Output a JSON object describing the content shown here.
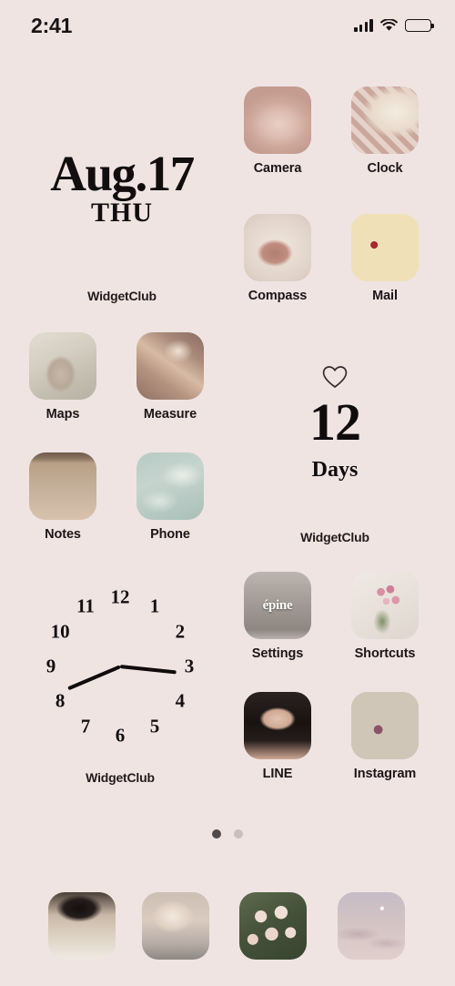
{
  "status_bar": {
    "time": "2:41",
    "signal_icon": "cellular-bars-icon",
    "wifi_icon": "wifi-icon",
    "battery_icon": "battery-full-icon"
  },
  "wallpaper_color": "#efe4e2",
  "widgets": {
    "date": {
      "date_text": "Aug.17",
      "day_of_week": "THU",
      "attribution": "WidgetClub"
    },
    "countdown": {
      "heart_icon": "heart-outline-icon",
      "number": "12",
      "unit": "Days",
      "attribution": "WidgetClub"
    },
    "clock": {
      "numerals": [
        "12",
        "1",
        "2",
        "3",
        "4",
        "5",
        "6",
        "7",
        "8",
        "9",
        "10",
        "11"
      ],
      "hour_hand_angle": 247,
      "minute_hand_angle": 96,
      "attribution": "WidgetClub"
    }
  },
  "apps": [
    {
      "label": "Camera",
      "icon_name": "camera-app-icon",
      "art": "glass-heart-perfume-bottle",
      "col": 0,
      "row": 0
    },
    {
      "label": "Clock",
      "icon_name": "clock-app-icon",
      "art": "white-cat-on-checkered-blanket",
      "col": 1,
      "row": 0
    },
    {
      "label": "Compass",
      "icon_name": "compass-app-icon",
      "art": "hand-in-bath-foam",
      "col": 0,
      "row": 1
    },
    {
      "label": "Mail",
      "icon_name": "mail-app-icon",
      "art": "cupcakes-on-tray",
      "col": 1,
      "row": 1
    },
    {
      "label": "Maps",
      "icon_name": "maps-app-icon",
      "art": "bunny-plush-on-bed",
      "col": 0,
      "row": 2
    },
    {
      "label": "Measure",
      "icon_name": "measure-app-icon",
      "art": "ornate-crystal-jewelry",
      "col": 1,
      "row": 2
    },
    {
      "label": "Notes",
      "icon_name": "notes-app-icon",
      "art": "clothes-on-hangers",
      "col": 0,
      "row": 3
    },
    {
      "label": "Phone",
      "icon_name": "phone-app-icon",
      "art": "teal-sea-foam-shore",
      "col": 1,
      "row": 3
    },
    {
      "label": "Settings",
      "icon_name": "settings-app-icon",
      "art": "epine-storefront",
      "art_text": "épine",
      "col": 0,
      "row": 4
    },
    {
      "label": "Shortcuts",
      "icon_name": "shortcuts-app-icon",
      "art": "pink-tulips-in-vase",
      "col": 1,
      "row": 4
    },
    {
      "label": "LINE",
      "icon_name": "line-app-icon",
      "art": "hands-forming-heart",
      "col": 0,
      "row": 5
    },
    {
      "label": "Instagram",
      "icon_name": "instagram-app-icon",
      "art": "heart-gemstone-rings",
      "col": 1,
      "row": 5
    }
  ],
  "page_indicator": {
    "total_pages": 2,
    "active_page": 1
  },
  "dock": [
    {
      "icon_name": "dock-icon-1",
      "art": "black-ribbon-gift-box-on-fur"
    },
    {
      "icon_name": "dock-icon-2",
      "art": "crystal-chandelier"
    },
    {
      "icon_name": "dock-icon-3",
      "art": "blush-rose-bouquet"
    },
    {
      "icon_name": "dock-icon-4",
      "art": "pink-sky-with-moon"
    }
  ]
}
